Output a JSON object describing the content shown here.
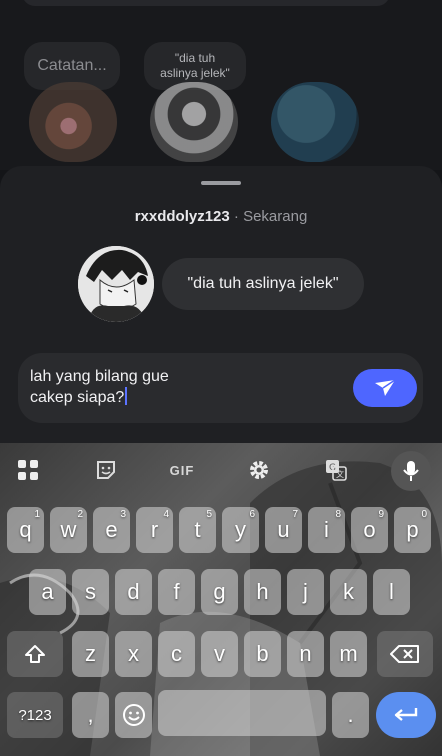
{
  "notes": {
    "bubble_1": "Catatan...",
    "bubble_2_line1": "\"dia tuh",
    "bubble_2_line2": "aslinya jelek\""
  },
  "reply_sheet": {
    "username": "rxxddolyz123",
    "separator": " · ",
    "time": "Sekarang",
    "message": "\"dia tuh aslinya jelek\"",
    "reply_text": "lah yang bilang gue\ncakep siapa?"
  },
  "keyboard": {
    "toolbar": {
      "gif": "GIF"
    },
    "rows": [
      [
        {
          "k": "q",
          "n": "1"
        },
        {
          "k": "w",
          "n": "2"
        },
        {
          "k": "e",
          "n": "3"
        },
        {
          "k": "r",
          "n": "4"
        },
        {
          "k": "t",
          "n": "5"
        },
        {
          "k": "y",
          "n": "6"
        },
        {
          "k": "u",
          "n": "7"
        },
        {
          "k": "i",
          "n": "8"
        },
        {
          "k": "o",
          "n": "9"
        },
        {
          "k": "p",
          "n": "0"
        }
      ],
      [
        {
          "k": "a"
        },
        {
          "k": "s"
        },
        {
          "k": "d"
        },
        {
          "k": "f"
        },
        {
          "k": "g"
        },
        {
          "k": "h"
        },
        {
          "k": "j"
        },
        {
          "k": "k"
        },
        {
          "k": "l"
        }
      ],
      [
        {
          "k": "z"
        },
        {
          "k": "x"
        },
        {
          "k": "c"
        },
        {
          "k": "v"
        },
        {
          "k": "b"
        },
        {
          "k": "n"
        },
        {
          "k": "m"
        }
      ]
    ],
    "symbols_key": "?123",
    "comma_key": ",",
    "period_key": "."
  },
  "colors": {
    "send_button": "#4e66ff",
    "enter_key": "#5b8ff0"
  }
}
